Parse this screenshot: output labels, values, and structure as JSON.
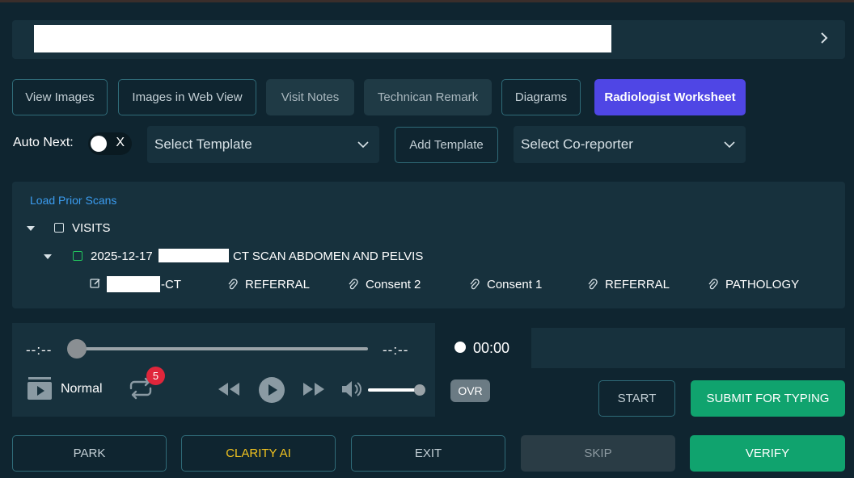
{
  "tabs": [
    {
      "label": "View Images",
      "style": "outline"
    },
    {
      "label": "Images in Web View",
      "style": "outline"
    },
    {
      "label": "Visit Notes",
      "style": "filled"
    },
    {
      "label": "Technican Remark",
      "style": "filled"
    },
    {
      "label": "Diagrams",
      "style": "outline"
    },
    {
      "label": "Radiologist Worksheet",
      "style": "active"
    }
  ],
  "controls": {
    "auto_next_label": "Auto Next:",
    "toggle_state_glyph": "X",
    "select_template_placeholder": "Select Template",
    "add_template_label": "Add Template",
    "select_coreporter_placeholder": "Select Co-reporter"
  },
  "prior_scans": {
    "load_label": "Load Prior Scans",
    "visits_label": "VISITS",
    "visit": {
      "date": "2025-12-17",
      "study": "CT SCAN ABDOMEN AND PELVIS",
      "item_suffix": "-CT",
      "attachments": [
        "REFERRAL",
        "Consent 2",
        "Consent 1",
        "REFERRAL",
        "PATHOLOGY"
      ]
    }
  },
  "player": {
    "time_start": "--:--",
    "time_end": "--:--",
    "speed_label": "Normal",
    "loop_count": "5",
    "volume_level": 1.0,
    "progress": 0.0
  },
  "recorder": {
    "ovr_label": "OVR",
    "time": "00:00",
    "start_label": "START",
    "submit_label": "SUBMIT FOR TYPING"
  },
  "footer": {
    "park_label": "PARK",
    "clarity_label": "CLARITY AI",
    "exit_label": "EXIT",
    "skip_label": "SKIP",
    "verify_label": "VERIFY"
  },
  "colors": {
    "background": "#0f2530",
    "panel": "#17313d",
    "accent_active": "#4f46e5",
    "accent_green": "#10a36e",
    "link_blue": "#3b9cf0",
    "badge_red": "#e0263b",
    "clarity_gold": "#f2c31f"
  }
}
